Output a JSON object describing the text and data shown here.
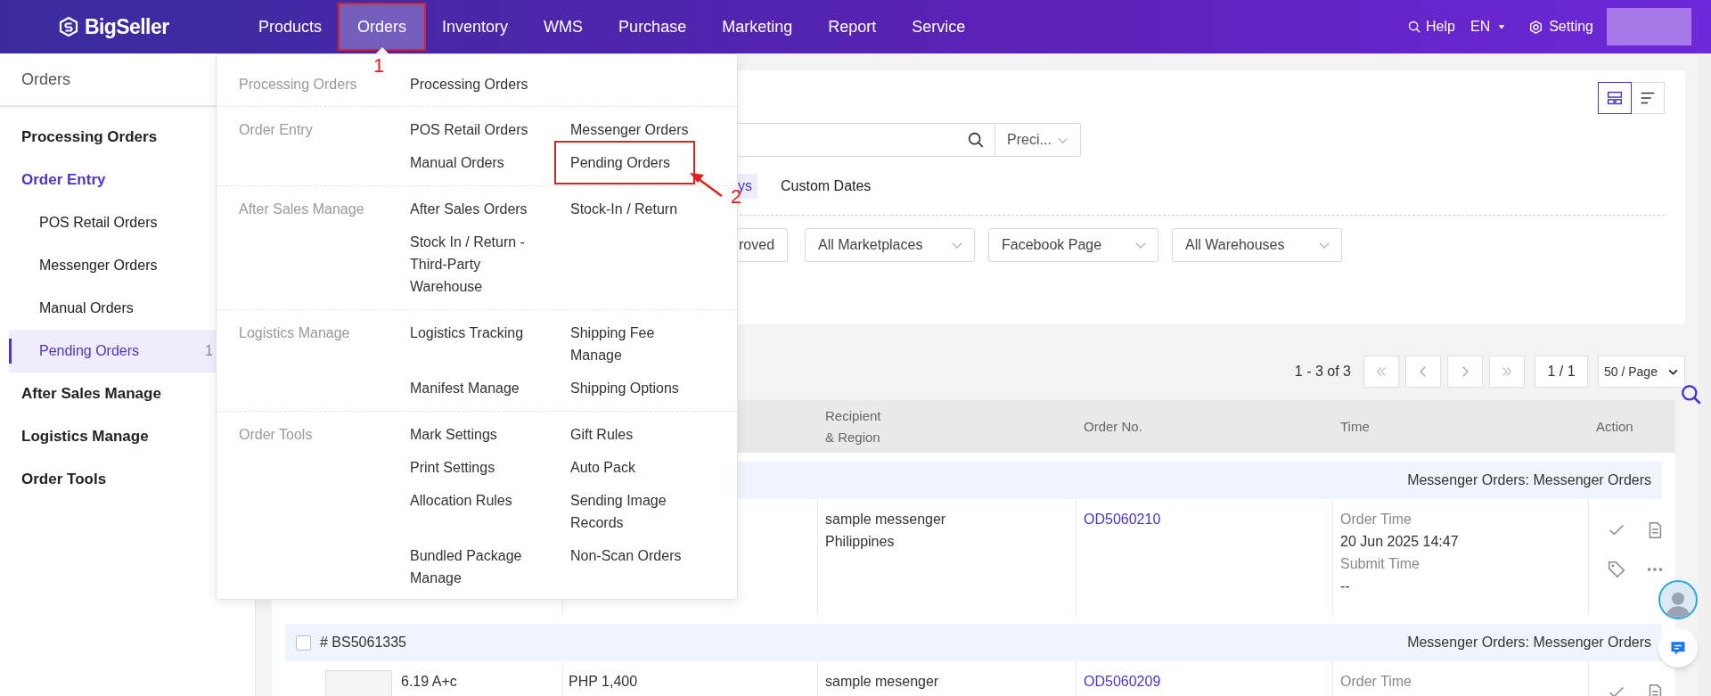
{
  "nav": {
    "logo": "BigSeller",
    "items": [
      {
        "label": "Products",
        "selected": false
      },
      {
        "label": "Orders",
        "selected": true,
        "annotation": "1"
      },
      {
        "label": "Inventory",
        "selected": false
      },
      {
        "label": "WMS",
        "selected": false
      },
      {
        "label": "Purchase",
        "selected": false
      },
      {
        "label": "Marketing",
        "selected": false
      },
      {
        "label": "Report",
        "selected": false
      },
      {
        "label": "Service",
        "selected": false
      }
    ],
    "help": "Help",
    "language": "EN",
    "setting": "Setting"
  },
  "sidebar": {
    "title": "Orders",
    "items": [
      {
        "label": "Processing Orders",
        "kind": "group",
        "expanded": false,
        "selected": false
      },
      {
        "label": "Order Entry",
        "kind": "group",
        "expanded": true,
        "selected": false
      },
      {
        "label": "POS Retail Orders",
        "kind": "sub",
        "selected": false
      },
      {
        "label": "Messenger Orders",
        "kind": "sub",
        "selected": false
      },
      {
        "label": "Manual Orders",
        "kind": "sub",
        "selected": false
      },
      {
        "label": "Pending Orders",
        "kind": "sub",
        "selected": true,
        "count": "1"
      },
      {
        "label": "After Sales Manage",
        "kind": "group",
        "expanded": false,
        "selected": false
      },
      {
        "label": "Logistics Manage",
        "kind": "group",
        "expanded": false,
        "selected": false
      },
      {
        "label": "Order Tools",
        "kind": "group",
        "expanded": false,
        "selected": false
      }
    ]
  },
  "menu": {
    "groups": [
      {
        "label": "Processing Orders",
        "items": [
          {
            "label": "Processing Orders"
          }
        ]
      },
      {
        "label": "Order Entry",
        "items": [
          {
            "label": "POS Retail Orders"
          },
          {
            "label": "Messenger Orders"
          },
          {
            "label": "Manual Orders"
          },
          {
            "label": "Pending Orders",
            "annotation": "2"
          }
        ]
      },
      {
        "label": "After Sales Manage",
        "items": [
          {
            "label": "After Sales Orders"
          },
          {
            "label": "Stock-In / Return"
          },
          {
            "label": "Stock In / Return - Third-Party Warehouse"
          }
        ]
      },
      {
        "label": "Logistics Manage",
        "items": [
          {
            "label": "Logistics Tracking"
          },
          {
            "label": "Shipping Fee Manage"
          },
          {
            "label": "Manifest Manage"
          },
          {
            "label": "Shipping Options"
          }
        ]
      },
      {
        "label": "Order Tools",
        "items": [
          {
            "label": "Mark Settings"
          },
          {
            "label": "Gift Rules"
          },
          {
            "label": "Print Settings"
          },
          {
            "label": "Auto Pack"
          },
          {
            "label": "Allocation Rules"
          },
          {
            "label": "Sending Image Records"
          },
          {
            "label": "Bundled Package Manage"
          },
          {
            "label": "Non-Scan Orders"
          }
        ]
      }
    ]
  },
  "filters": {
    "view_toggle": [
      {
        "kind": "card",
        "selected": true
      },
      {
        "kind": "list",
        "selected": false
      }
    ],
    "match_select": "Preci...",
    "date_tabs": [
      {
        "label": "ys",
        "selected": true
      },
      {
        "label": "Custom Dates",
        "selected": false
      }
    ],
    "controls": [
      {
        "kind": "button",
        "label": "roved"
      },
      {
        "kind": "select",
        "label": "All Marketplaces"
      },
      {
        "kind": "select",
        "label": "Facebook Page"
      },
      {
        "kind": "select",
        "label": "All Warehouses"
      }
    ]
  },
  "pagination": {
    "summary": "1 - 3 of 3",
    "page": "1 / 1",
    "page_size": "50 / Page"
  },
  "table": {
    "columns": [
      {
        "lines": [
          "Recipient",
          "& Region"
        ]
      },
      {
        "lines": [
          "Order No."
        ]
      },
      {
        "lines": [
          "Time"
        ]
      },
      {
        "lines": [
          "Action"
        ]
      }
    ],
    "orders": [
      {
        "source": "Messenger Orders: Messenger Orders",
        "recipient": "sample messenger",
        "region": "Philippines",
        "order_no": "OD5060210",
        "time_label": "Order Time",
        "time": "20 Jun 2025 14:47",
        "submit_label": "Submit Time",
        "submit": "--"
      },
      {
        "id": "# BS5061335",
        "checked": false,
        "source": "Messenger Orders: Messenger Orders",
        "product": "6.19 A+c",
        "price": "PHP 1,400",
        "recipient": "sample mesenger",
        "order_no": "OD5060209",
        "time_label": "Order Time"
      }
    ]
  }
}
